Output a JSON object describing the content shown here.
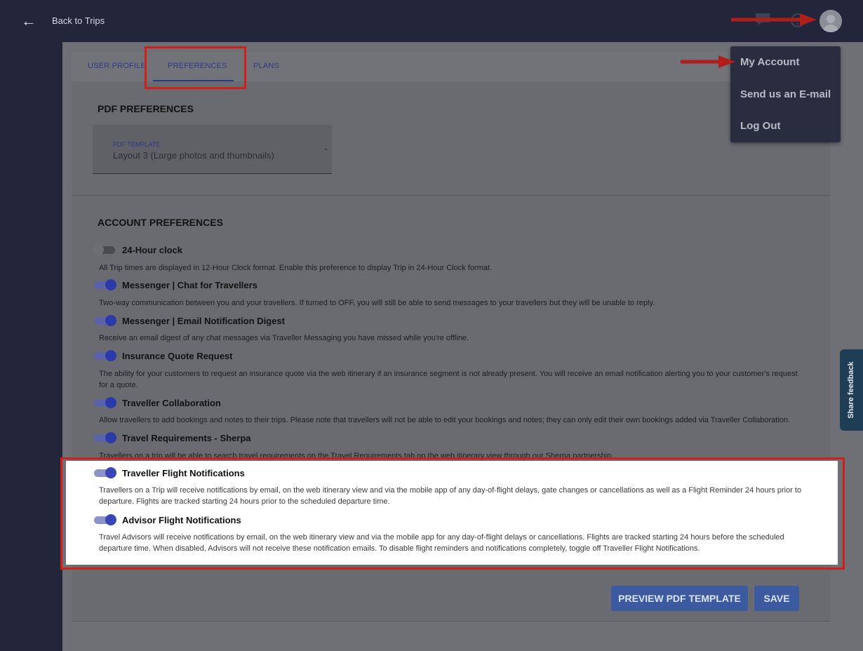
{
  "header": {
    "back_label": "Back to Trips"
  },
  "tabs": [
    {
      "label": "USER PROFILE"
    },
    {
      "label": "PREFERENCES"
    },
    {
      "label": "PLANS"
    }
  ],
  "pdf": {
    "section_title": "PDF PREFERENCES",
    "template_label": "PDF TEMPLATE",
    "template_value": "Layout 3 (Large photos and thumbnails)"
  },
  "account": {
    "section_title": "ACCOUNT PREFERENCES",
    "prefs": [
      {
        "title": "24-Hour clock",
        "enabled": false,
        "desc": "All Trip times are displayed in 12-Hour Clock format. Enable this preference to display Trip in 24-Hour Clock format."
      },
      {
        "title": "Messenger | Chat for Travellers",
        "enabled": true,
        "desc": "Two-way communication between you and your travellers. If turned to OFF, you will still be able to send messages to your travellers but they will be unable to reply."
      },
      {
        "title": "Messenger | Email Notification Digest",
        "enabled": true,
        "desc": "Receive an email digest of any chat messages via Traveller Messaging you have missed while you're offline."
      },
      {
        "title": "Insurance Quote Request",
        "enabled": true,
        "desc": "The ability for your customers to request an insurance quote via the web itinerary if an insurance segment is not already present. You will receive an email notification alerting you to your customer's request for a quote."
      },
      {
        "title": "Traveller Collaboration",
        "enabled": true,
        "desc": "Allow travellers to add bookings and notes to their trips. Please note that travellers will not be able to edit your bookings and notes; they can only edit their own bookings added via Traveller Collaboration."
      },
      {
        "title": "Travel Requirements - Sherpa",
        "enabled": true,
        "desc": "Travellers on a trip will be able to search travel requirements on the Travel Requirements tab on the web itinerary view through our Sherpa partnership."
      },
      {
        "title": "Traveller Flight Notifications",
        "enabled": true,
        "desc": "Travellers on a Trip will receive notifications by email, on the web itinerary view and via the mobile app of any day-of-flight delays, gate changes or cancellations as well as a Flight Reminder 24 hours prior to departure. Flights are tracked starting 24 hours prior to the scheduled departure time."
      },
      {
        "title": "Advisor Flight Notifications",
        "enabled": true,
        "desc": "Travel Advisors will receive notifications by email, on the web itinerary view and via the mobile app for any day-of-flight delays or cancellations. Flights are tracked starting 24 hours before the scheduled departure time. When disabled, Advisors will not receive these notification emails. To disable flight reminders and notifications completely, toggle off Traveller Flight Notifications."
      }
    ]
  },
  "buttons": {
    "preview": "PREVIEW PDF TEMPLATE",
    "save": "SAVE"
  },
  "account_menu": {
    "items": [
      {
        "label": "My Account"
      },
      {
        "label": "Send us an E-mail"
      },
      {
        "label": "Log Out"
      }
    ]
  },
  "feedback": {
    "label": "Share feedback"
  },
  "colors": {
    "accent": "#2b3aa8",
    "annotation": "#d0201c",
    "topbar": "#23263a"
  }
}
